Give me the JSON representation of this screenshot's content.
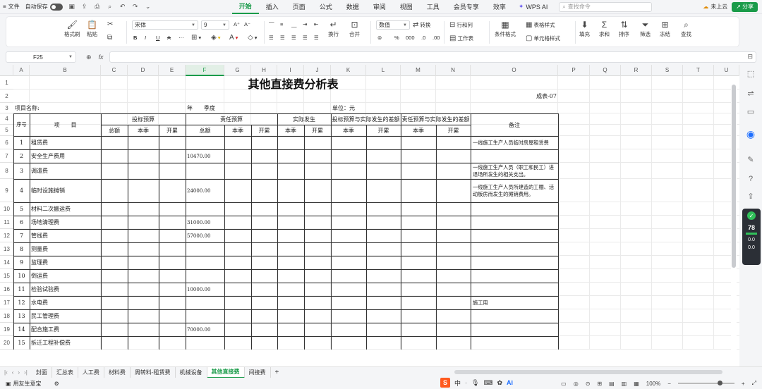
{
  "topbar": {
    "file": "文件",
    "autosave": "自动保存",
    "tabs": [
      "开始",
      "插入",
      "页面",
      "公式",
      "数据",
      "审阅",
      "视图",
      "工具",
      "会员专享",
      "效率"
    ],
    "active_tab": 0,
    "wps_ai": "WPS AI",
    "search_placeholder": "查找命令",
    "cloud": "未上云",
    "share": "分享"
  },
  "ribbon": {
    "format_painter": "格式刷",
    "paste": "粘贴",
    "font_name": "宋体",
    "font_size": "9",
    "number_format": "数值",
    "convert": "转换",
    "rows_cols": "行和列",
    "wrap": "换行",
    "merge": "合并",
    "worksheet": "工作表",
    "table_style": "表格样式",
    "cond_format": "条件格式",
    "cell_style": "单元格样式",
    "fill": "填充",
    "sum": "求和",
    "sort": "排序",
    "filter": "筛选",
    "freeze": "冻结",
    "find": "查找"
  },
  "formula_bar": {
    "cell_ref": "F25",
    "fx": "fx"
  },
  "grid": {
    "columns": [
      "A",
      "B",
      "C",
      "D",
      "E",
      "F",
      "G",
      "H",
      "I",
      "J",
      "K",
      "L",
      "M",
      "N",
      "O",
      "P",
      "Q",
      "R",
      "S",
      "T",
      "U"
    ],
    "selected_column": "F",
    "rows": [
      "1",
      "2",
      "3",
      "4",
      "5",
      "6",
      "7",
      "8",
      "9",
      "10",
      "11",
      "12",
      "13",
      "14",
      "15",
      "16",
      "17",
      "18",
      "19",
      "20"
    ]
  },
  "sheet": {
    "title": "其他直接费分析表",
    "form_no": "成表-07",
    "project_label": "项目名称:",
    "year_quarter": "年　　季度",
    "unit": "单位：元",
    "headers": {
      "seq": "序号",
      "item": "项　　目",
      "bid_budget": "投标预算",
      "resp_budget": "责任预算",
      "actual": "实际发生",
      "diff1": "投标预算与实际发生的差额",
      "diff2": "责任预算与实际发生的差额",
      "remark": "备注",
      "total": "总额",
      "this_q": "本季",
      "cumulative": "开累"
    },
    "items": [
      {
        "no": "1",
        "name": "租赁费",
        "resp": "",
        "remark": "一线施工生产人员临时房屋租赁费"
      },
      {
        "no": "2",
        "name": "安全生产费用",
        "resp": "10470.00",
        "remark": ""
      },
      {
        "no": "3",
        "name": "调遣费",
        "resp": "",
        "remark": "一线施工生产人员（职工和民工）进退场所发生的相关支出。"
      },
      {
        "no": "4",
        "name": "临时设施摊销",
        "resp": "24000.00",
        "remark": "一线施工生产人员所建造的工棚、活动板房而发生的摊销费用。"
      },
      {
        "no": "5",
        "name": "材料二次搬运费",
        "resp": "",
        "remark": ""
      },
      {
        "no": "6",
        "name": "场地清理费",
        "resp": "31000.00",
        "remark": ""
      },
      {
        "no": "7",
        "name": "管线费",
        "resp": "57000.00",
        "remark": ""
      },
      {
        "no": "8",
        "name": "测量费",
        "resp": "",
        "remark": ""
      },
      {
        "no": "9",
        "name": "监理费",
        "resp": "",
        "remark": ""
      },
      {
        "no": "10",
        "name": "倒运费",
        "resp": "",
        "remark": ""
      },
      {
        "no": "11",
        "name": "检验试验费",
        "resp": "10000.00",
        "remark": ""
      },
      {
        "no": "12",
        "name": "水电费",
        "resp": "",
        "remark": "施工用"
      },
      {
        "no": "13",
        "name": "民工管理费",
        "resp": "",
        "remark": ""
      },
      {
        "no": "14",
        "name": "配合施工费",
        "resp": "70000.00",
        "remark": ""
      },
      {
        "no": "15",
        "name": "拆迁工程补偿费",
        "resp": "",
        "remark": ""
      }
    ]
  },
  "sheet_tabs": [
    "封面",
    "汇总表",
    "人工费",
    "材料费",
    "周转料-租赁费",
    "机械设备",
    "其他直接费",
    "间接费"
  ],
  "active_sheet": 6,
  "status": {
    "user": "用友生意宝",
    "zoom": "100%"
  },
  "colors": {
    "accent": "#1a9b4a",
    "share_bg": "#1a9b4a"
  }
}
